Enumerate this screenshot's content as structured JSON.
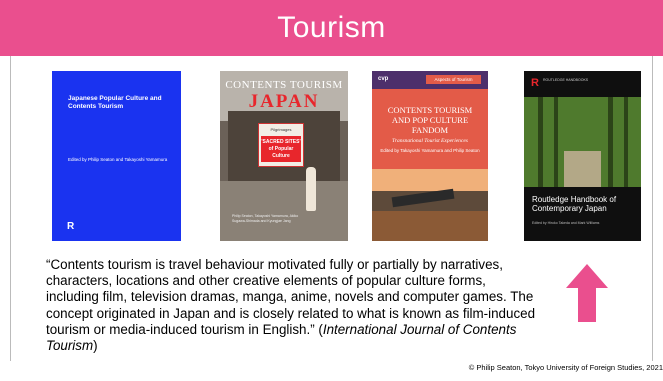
{
  "slide": {
    "title": "Tourism",
    "colors": {
      "header": "#ea4f8e",
      "arrow": "#ea4f8e"
    }
  },
  "books": [
    {
      "title": "Japanese Popular Culture and Contents Tourism",
      "editors": "Edited by Philip Seaton and Takayoshi Yamamura",
      "publisher_logo": "R"
    },
    {
      "title_line1": "CONTENTS TOURISM",
      "title_line2": "JAPAN",
      "badge_top": "Pilgrimages",
      "badge_main": "'SACRED SITES' of Popular Culture",
      "authors": "Philip Seaton, Takayoshi Yamamura, Akiko Sugawa-Shimada and Kyungjae Jang"
    },
    {
      "publisher": "cvp",
      "series": "Aspects of Tourism",
      "title": "CONTENTS TOURISM AND POP CULTURE FANDOM",
      "subtitle": "Transnational Tourist Experiences",
      "editors": "Edited by Takayoshi Yamamura and Philip Seaton"
    },
    {
      "publisher_logo": "R",
      "series": "ROUTLEDGE HANDBOOKS",
      "title": "Routledge Handbook of Contemporary Japan",
      "editors": "Edited by Hiroko Takeda and Mark Williams"
    }
  ],
  "quote": {
    "text": "“Contents tourism is travel behaviour motivated fully or partially by narratives, characters, locations and other creative elements of popular culture forms, including film, television dramas, manga, anime, novels and computer games. The concept originated in Japan and is closely related to what is known as film-induced tourism or media-induced tourism in English.” (",
    "source": "International Journal of Contents Tourism",
    "close": ")"
  },
  "footer": "© Philip Seaton, Tokyo University of Foreign Studies, 2021"
}
